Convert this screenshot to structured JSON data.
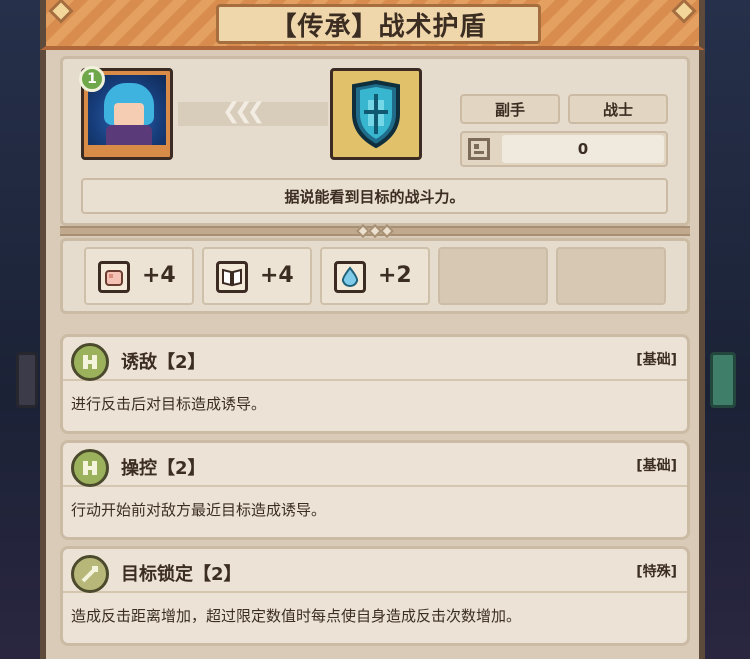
{
  "title": "【传承】战术护盾",
  "hero": {
    "level": "1"
  },
  "tags": {
    "slot": "副手",
    "class": "战士"
  },
  "stat": {
    "value": "0"
  },
  "description": "据说能看到目标的战斗力。",
  "bonuses": [
    {
      "icon": "fist-icon",
      "value": "+4",
      "color": "#f3c2b4"
    },
    {
      "icon": "book-icon",
      "value": "+4",
      "color": "#ffffff"
    },
    {
      "icon": "water-drop-icon",
      "value": "+2",
      "color": "#7fcbe9"
    }
  ],
  "skills": [
    {
      "name": "诱敌【2】",
      "type": "[基础]",
      "desc": "进行反击后对目标造成诱导。"
    },
    {
      "name": "操控【2】",
      "type": "[基础]",
      "desc": "行动开始前对敌方最近目标造成诱导。"
    },
    {
      "name": "目标锁定【2】",
      "type": "[特殊]",
      "desc": "造成反击距离增加，超过限定数值时每点使自身造成反击次数增加。"
    }
  ]
}
